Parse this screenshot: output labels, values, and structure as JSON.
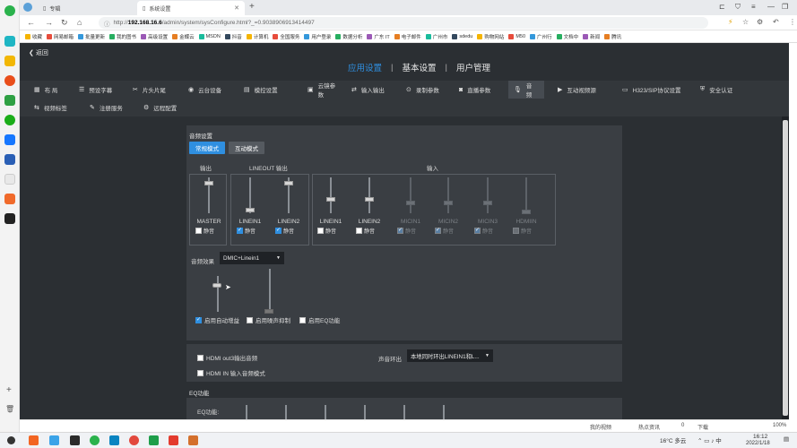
{
  "browser": {
    "tabs": [
      {
        "title": "专辑",
        "active": false
      },
      {
        "title": "系统设置",
        "active": true
      }
    ],
    "url_host": "192.168.16.6",
    "url_path": "/admin/system/sysConfigure.html?_=0.9038906913414497",
    "url_prefix": "http://",
    "bookmarks": [
      "收藏",
      "网易邮箱",
      "批量更新",
      "我的图书",
      "高级设置",
      "金蝶云",
      "MSDN",
      "抖音",
      "计算机",
      "全国服务",
      "用户登录",
      "数据分析",
      "广东 IT",
      "电子邮件",
      "广州市",
      "sdedu",
      "购物网站",
      "M50",
      "广州行",
      "文档中",
      "新闻",
      "腾讯"
    ]
  },
  "app": {
    "back_label": "返回",
    "topnav": [
      "应用设置",
      "基本设置",
      "用户管理"
    ],
    "menu_row1": [
      {
        "icon": "grid-icon",
        "glyph": "▦",
        "label": "布 局"
      },
      {
        "icon": "list-icon",
        "glyph": "☰",
        "label": "预设字幕"
      },
      {
        "icon": "tools-icon",
        "glyph": "✂",
        "label": "片头片尾"
      },
      {
        "icon": "camera-icon",
        "glyph": "◉",
        "label": "云台设备"
      },
      {
        "icon": "monitor-icon",
        "glyph": "▤",
        "label": "模控设置"
      },
      {
        "icon": "photo-icon",
        "glyph": "▣",
        "label": "云镜参数"
      },
      {
        "icon": "swap-icon",
        "glyph": "⇄",
        "label": "输入输出"
      },
      {
        "icon": "record-icon",
        "glyph": "⊙",
        "label": "录制参数"
      },
      {
        "icon": "stream-icon",
        "glyph": "◙",
        "label": "直播参数"
      },
      {
        "icon": "mic-icon",
        "glyph": "🎙",
        "label": "音 频"
      },
      {
        "icon": "video-icon",
        "glyph": "▶",
        "label": "互动视频源"
      },
      {
        "icon": "protocol-icon",
        "glyph": "▭",
        "label": "H323/SIP协议设置"
      },
      {
        "icon": "shield-icon",
        "glyph": "⛨",
        "label": "安全认证"
      }
    ],
    "menu_row2": [
      {
        "icon": "video-label-icon",
        "glyph": "⇆",
        "label": "视频标签"
      },
      {
        "icon": "register-icon",
        "glyph": "✎",
        "label": "注册服务"
      },
      {
        "icon": "remote-icon",
        "glyph": "⚙",
        "label": "远程配置"
      }
    ],
    "audio": {
      "section_title": "音频设置",
      "modes": [
        "常规模式",
        "互动模式"
      ],
      "group_labels": {
        "output": "输出",
        "lineout": "LINEOUT 输出",
        "input": "输入"
      },
      "mute_label": "静音",
      "channels": [
        {
          "name": "MASTER",
          "muted": false,
          "dim": false
        },
        {
          "name": "LINEIN1",
          "muted": true,
          "dim": false
        },
        {
          "name": "LINEIN2",
          "muted": true,
          "dim": false
        },
        {
          "name": "LINEIN1",
          "muted": false,
          "dim": false
        },
        {
          "name": "LINEIN2",
          "muted": false,
          "dim": false
        },
        {
          "name": "MICIN1",
          "muted": true,
          "dim": true
        },
        {
          "name": "MICIN2",
          "muted": true,
          "dim": true
        },
        {
          "name": "MICIN3",
          "muted": true,
          "dim": true
        },
        {
          "name": "HDMIIN",
          "muted": false,
          "dim": true
        }
      ],
      "effect_label": "音频效果",
      "effect_value": "DMIC+Linein1",
      "options": [
        {
          "label": "启用自动增益",
          "checked": true
        },
        {
          "label": "启用噪声抑制",
          "checked": false
        },
        {
          "label": "启用EQ功能",
          "checked": false
        }
      ],
      "hdmi_out": "HDMI out3输出音频",
      "hdmi_in": "HDMI IN 输入音频模式",
      "sound_out_label": "声音环出",
      "sound_out_value": "本地同时环出LINEIN1和L..."
    },
    "eq": {
      "section_title": "EQ功能",
      "eq_label": "EQ功能:"
    }
  },
  "statusbar": [
    "我的视频",
    "热点资讯",
    "0",
    "下载",
    "100%"
  ],
  "taskbar": {
    "weather": "16°C 多云",
    "time": "16:12",
    "date": "2022/1/18"
  }
}
